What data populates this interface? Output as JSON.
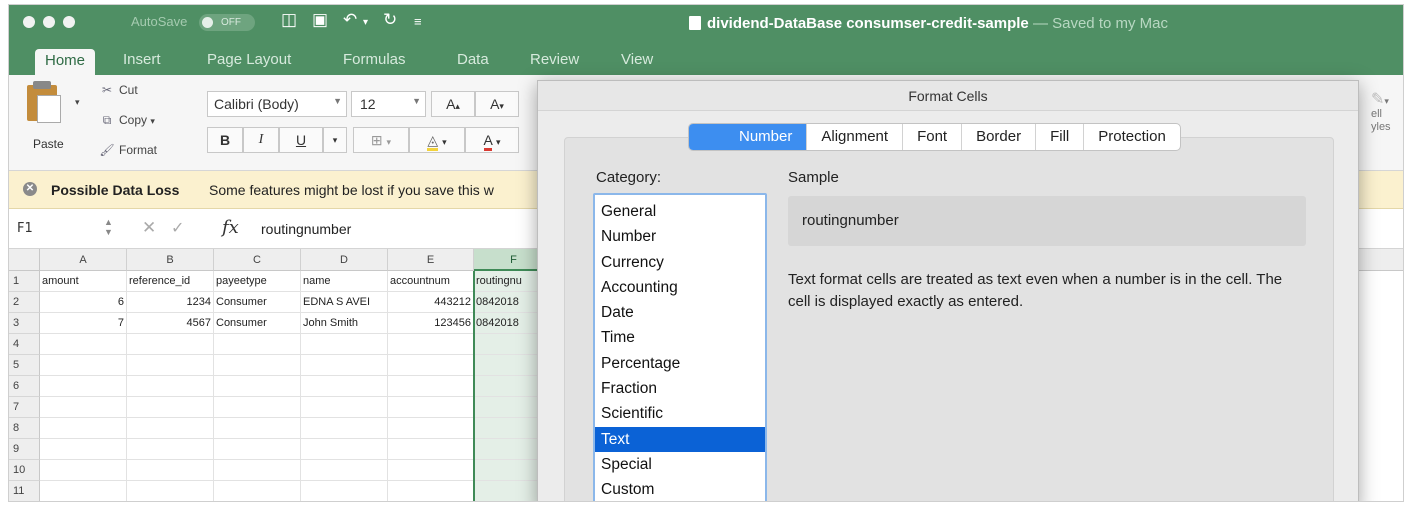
{
  "titlebar": {
    "autosave_label": "AutoSave",
    "autosave_state": "OFF",
    "document_title": "dividend-DataBase consumser-credit-sample",
    "saved_status": "— Saved to my Mac"
  },
  "ribbon_tabs": [
    "Home",
    "Insert",
    "Page Layout",
    "Formulas",
    "Data",
    "Review",
    "View"
  ],
  "ribbon": {
    "paste_label": "Paste",
    "cut_label": "Cut",
    "copy_label": "Copy",
    "format_label": "Format",
    "font_name": "Calibri (Body)",
    "font_size": "12",
    "bold": "B",
    "italic": "I",
    "underline": "U",
    "grow_font": "A",
    "shrink_font": "A",
    "right_partial": "ell\nyles"
  },
  "warning": {
    "title": "Possible Data Loss",
    "message": "Some features might be lost if you save this w"
  },
  "formula_bar": {
    "name_box": "F1",
    "fx": "fx",
    "value": "routingnumber"
  },
  "sheet": {
    "columns": [
      "A",
      "B",
      "C",
      "D",
      "E",
      "F"
    ],
    "selected_column": "F",
    "row_numbers": [
      "1",
      "2",
      "3",
      "4",
      "5",
      "6",
      "7",
      "8",
      "9",
      "10",
      "11"
    ],
    "rows": [
      [
        "amount",
        "reference_id",
        "payeetype",
        "name",
        "accountnum",
        "routingnu"
      ],
      [
        "6",
        "1234",
        "Consumer",
        "EDNA S AVEI",
        "443212",
        "0842018"
      ],
      [
        "7",
        "4567",
        "Consumer",
        "John Smith",
        "123456",
        "0842018"
      ]
    ]
  },
  "dialog": {
    "title": "Format Cells",
    "tabs": [
      "Number",
      "Alignment",
      "Font",
      "Border",
      "Fill",
      "Protection"
    ],
    "active_tab": "Number",
    "category_label": "Category:",
    "categories": [
      "General",
      "Number",
      "Currency",
      "Accounting",
      "Date",
      "Time",
      "Percentage",
      "Fraction",
      "Scientific",
      "Text",
      "Special",
      "Custom"
    ],
    "selected_category": "Text",
    "sample_label": "Sample",
    "sample_value": "routingnumber",
    "description": "Text format cells are treated as text even when a number is in the cell.  The cell is displayed exactly as entered."
  },
  "colors": {
    "excel_green": "#4f8f64",
    "selection_blue": "#0b62d6",
    "segment_blue": "#3d8ef0",
    "warning_bg": "#fbf1cf"
  }
}
